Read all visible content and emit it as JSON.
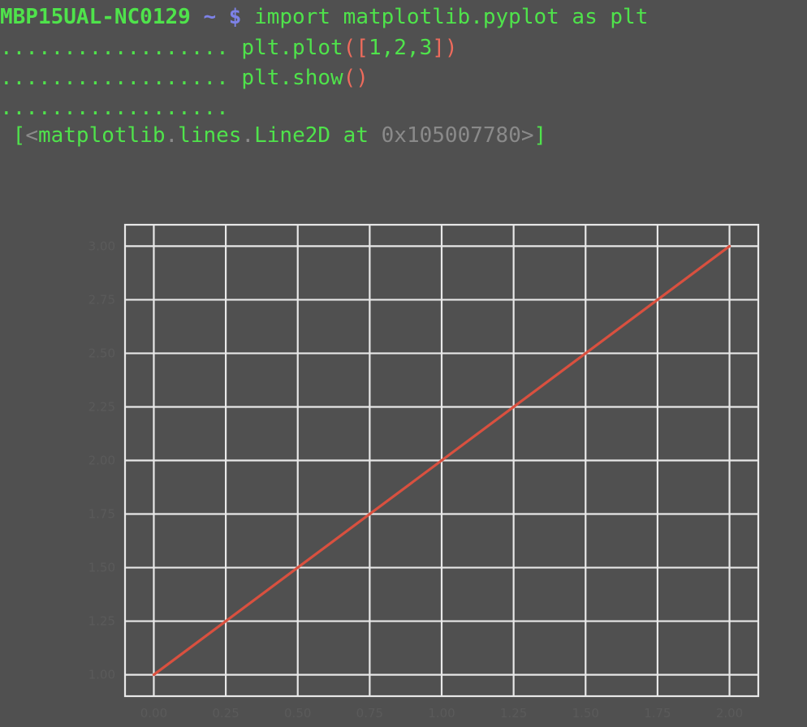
{
  "terminal": {
    "prompt_host": "MBP15UAL-NC0129",
    "prompt_tilde": "~",
    "prompt_dollar": "$",
    "line1_code": "import matplotlib.pyplot as plt",
    "continuation": "..................",
    "line2_prefix": "plt.plot",
    "line2_open": "([",
    "line2_args": "1,2,3",
    "line2_close": "])",
    "line3_prefix": "plt.show",
    "line3_parens": "()",
    "output_open": "[",
    "output_lt": "<",
    "output_mod1": "matplotlib",
    "output_dot1": ".",
    "output_mod2": "lines",
    "output_dot2": ".",
    "output_cls": "Line2D at ",
    "output_addr": "0x105007780",
    "output_gt": ">",
    "output_close": "]"
  },
  "colors": {
    "background": "#505050",
    "prompt_green": "#4fe34b",
    "prompt_blue": "#7d82e8",
    "paren_red": "#ee6b5c",
    "line_color": "#d9503f",
    "grid_color": "#e8e8e8"
  },
  "chart_data": {
    "type": "line",
    "x": [
      0,
      1,
      2
    ],
    "series": [
      {
        "values": [
          1,
          2,
          3
        ]
      }
    ],
    "xlim": [
      -0.1,
      2.1
    ],
    "ylim": [
      0.9,
      3.1
    ],
    "x_ticks": [
      "0.00",
      "0.25",
      "0.50",
      "0.75",
      "1.00",
      "1.25",
      "1.50",
      "1.75",
      "2.00"
    ],
    "y_ticks": [
      "1.00",
      "1.25",
      "1.50",
      "1.75",
      "2.00",
      "2.25",
      "2.50",
      "2.75",
      "3.00"
    ],
    "grid": true,
    "title": "",
    "xlabel": "",
    "ylabel": ""
  }
}
